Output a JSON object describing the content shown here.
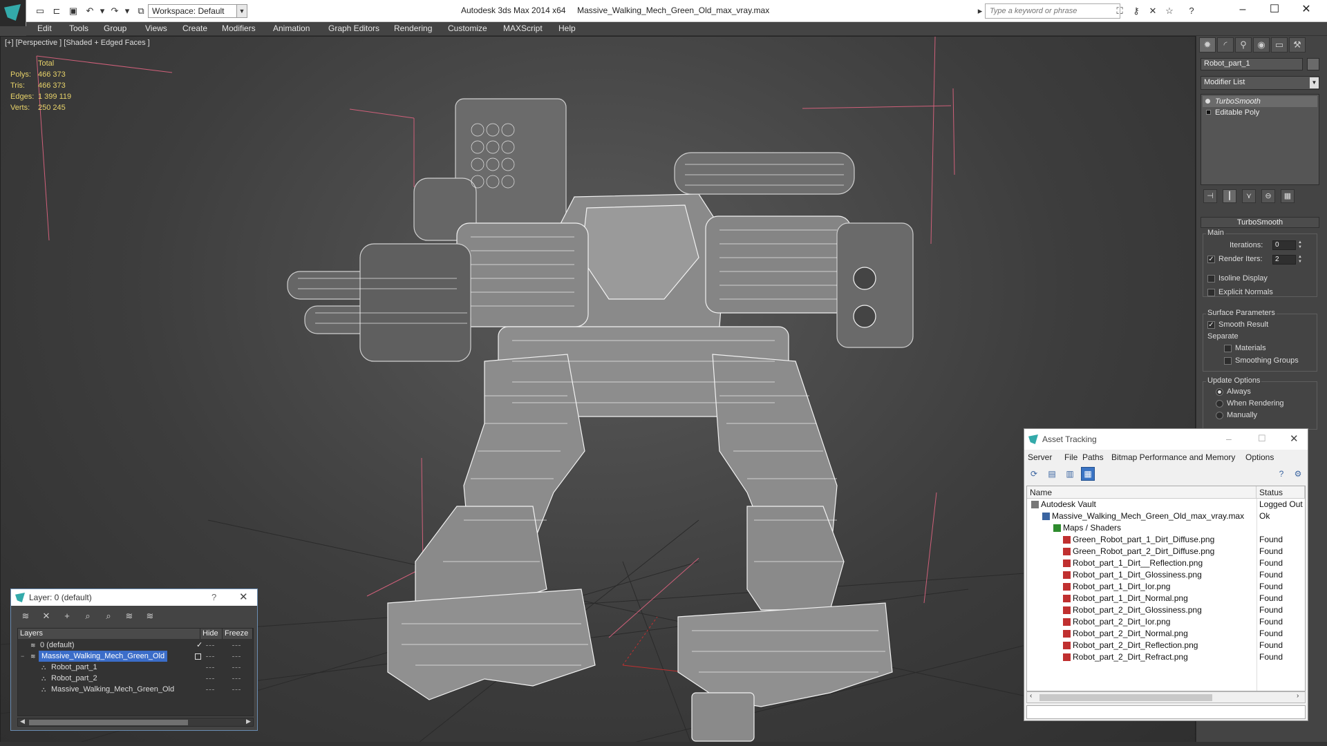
{
  "titlebar": {
    "app": "Autodesk 3ds Max  2014 x64",
    "file": "Massive_Walking_Mech_Green_Old_max_vray.max",
    "workspace": "Workspace: Default",
    "search_placeholder": "Type a keyword or phrase"
  },
  "menubar": [
    "Edit",
    "Tools",
    "Group",
    "Views",
    "Create",
    "Modifiers",
    "Animation",
    "Graph Editors",
    "Rendering",
    "Customize",
    "MAXScript",
    "Help"
  ],
  "viewport": {
    "label": "[+] [Perspective ] [Shaded + Edged Faces ]",
    "stats": {
      "header": "Total",
      "rows": [
        {
          "label": "Polys:",
          "value": "466 373"
        },
        {
          "label": "Tris:",
          "value": "466 373"
        },
        {
          "label": "Edges:",
          "value": "1 399 119"
        },
        {
          "label": "Verts:",
          "value": "250 245"
        }
      ]
    }
  },
  "command_panel": {
    "object_name": "Robot_part_1",
    "modifier_list": "Modifier List",
    "stack": [
      "TurboSmooth",
      "Editable Poly"
    ],
    "turbosmooth": {
      "title": "TurboSmooth",
      "main_label": "Main",
      "iterations_label": "Iterations:",
      "iterations_value": "0",
      "render_iters_label": "Render Iters:",
      "render_iters_value": "2",
      "isoline": "Isoline Display",
      "explicit": "Explicit Normals",
      "surface_label": "Surface Parameters",
      "smooth_result": "Smooth Result",
      "separate_label": "Separate",
      "materials": "Materials",
      "smoothing_groups": "Smoothing Groups",
      "update_label": "Update Options",
      "always": "Always",
      "when_rendering": "When Rendering",
      "manually": "Manually"
    }
  },
  "layer_dialog": {
    "title": "Layer: 0 (default)",
    "help": "?",
    "columns": [
      "Layers",
      "Hide",
      "Freeze"
    ],
    "rows": [
      {
        "name": "0 (default)",
        "indent": 1
      },
      {
        "name": "Massive_Walking_Mech_Green_Old",
        "indent": 1
      },
      {
        "name": "Robot_part_1",
        "indent": 2
      },
      {
        "name": "Robot_part_2",
        "indent": 2
      },
      {
        "name": "Massive_Walking_Mech_Green_Old",
        "indent": 2
      }
    ]
  },
  "asset_tracking": {
    "title": "Asset Tracking",
    "menu": [
      "Server",
      "File",
      "Paths",
      "Bitmap Performance and Memory",
      "Options"
    ],
    "columns": [
      "Name",
      "Status"
    ],
    "rows": [
      {
        "name": "Autodesk Vault",
        "status": "Logged Out",
        "level": 0
      },
      {
        "name": "Massive_Walking_Mech_Green_Old_max_vray.max",
        "status": "Ok",
        "level": 1
      },
      {
        "name": "Maps / Shaders",
        "status": "",
        "level": 2
      },
      {
        "name": "Green_Robot_part_1_Dirt_Diffuse.png",
        "status": "Found",
        "level": 3
      },
      {
        "name": "Green_Robot_part_2_Dirt_Diffuse.png",
        "status": "Found",
        "level": 3
      },
      {
        "name": "Robot_part_1_Dirt__Reflection.png",
        "status": "Found",
        "level": 3
      },
      {
        "name": "Robot_part_1_Dirt_Glossiness.png",
        "status": "Found",
        "level": 3
      },
      {
        "name": "Robot_part_1_Dirt_Ior.png",
        "status": "Found",
        "level": 3
      },
      {
        "name": "Robot_part_1_Dirt_Normal.png",
        "status": "Found",
        "level": 3
      },
      {
        "name": "Robot_part_2_Dirt_Glossiness.png",
        "status": "Found",
        "level": 3
      },
      {
        "name": "Robot_part_2_Dirt_Ior.png",
        "status": "Found",
        "level": 3
      },
      {
        "name": "Robot_part_2_Dirt_Normal.png",
        "status": "Found",
        "level": 3
      },
      {
        "name": "Robot_part_2_Dirt_Reflection.png",
        "status": "Found",
        "level": 3
      },
      {
        "name": "Robot_part_2_Dirt_Refract.png",
        "status": "Found",
        "level": 3
      }
    ]
  },
  "colors": {
    "stats_text": "#e8d36a",
    "selection": "#3b6dc9",
    "bracket_lines": "#d0607a"
  }
}
